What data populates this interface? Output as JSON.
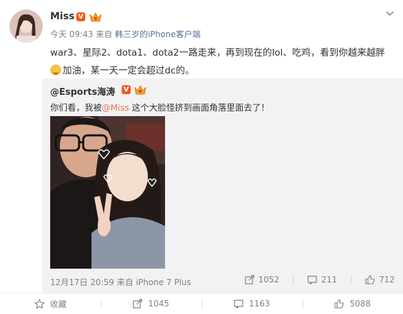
{
  "post": {
    "username": "Miss",
    "verified_badge": "V",
    "meta_time": "今天 09:43",
    "meta_from": "来自",
    "meta_source": "韩三岁的iPhone客户端",
    "text_line1": "war3、星际2、dota1、dota2一路走来，再到现在的lol、吃鸡，看到你越来越胖",
    "text_line2": "加油，某一天一定会超过dc的。",
    "emoji_icon": "laugh-cry-emoji"
  },
  "repost": {
    "username": "@Esports海涛",
    "verified_badge": "V",
    "text_before": "你们看，我被",
    "mention": "@Miss",
    "text_after": " 这个大脸怪挤到画面角落里面去了！",
    "meta": "12月17日 20:59 来自 iPhone 7 Plus",
    "share_count": "1052",
    "comment_count": "211",
    "like_count": "712"
  },
  "footer": {
    "favorite_label": "收藏",
    "share_count": "1045",
    "comment_count": "1163",
    "like_count": "5088"
  },
  "colors": {
    "accent_orange": "#eb7350",
    "badge": "#f25a1e",
    "source_link": "#5a6f98",
    "repost_bg": "#f2f2f5"
  }
}
